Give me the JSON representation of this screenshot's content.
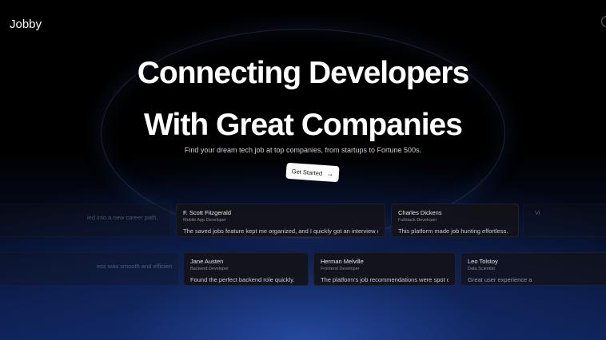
{
  "brand": {
    "name": "Jobby"
  },
  "hero": {
    "title_line1": "Connecting Developers",
    "title_line2": "With Great Companies",
    "subtitle": "Find your dream tech job at top companies, from startups to Fortune 500s.",
    "cta_label": "Get Started",
    "cta_icon": "arrow-right-icon"
  },
  "testimonials_row1": [
    {
      "name": "",
      "role": "",
      "quote": "ied into a new career path."
    },
    {
      "name": "F. Scott Fitzgerald",
      "role": "Mobile App Developer",
      "quote": "The saved jobs feature kept me organized, and I quickly got an interview call!"
    },
    {
      "name": "Charles Dickens",
      "role": "Fullstack Developer",
      "quote": "This platform made job hunting effortless."
    },
    {
      "name": "Vi",
      "role": "",
      "quote": ""
    }
  ],
  "testimonials_row2": [
    {
      "name": "",
      "role": "",
      "quote": "ess was smooth and efficient"
    },
    {
      "name": "Jane Austen",
      "role": "Backend Developer",
      "quote": "Found the perfect backend role quickly."
    },
    {
      "name": "Herman Melville",
      "role": "Frontend Developer",
      "quote": "The platform's job recommendations were spot on."
    },
    {
      "name": "Leo Tolstoy",
      "role": "Data Scientist",
      "quote": "Great user experience a"
    }
  ],
  "colors": {
    "background": "#000000",
    "glow": "#2850aa",
    "cta_bg": "#ffffff"
  }
}
